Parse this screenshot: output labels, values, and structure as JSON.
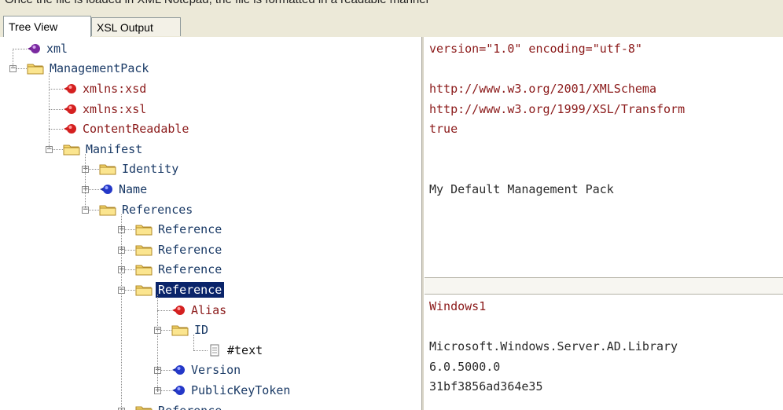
{
  "top_strip_text": "Once the file is loaded in XML Notepad, the file is formatted in a readable manner",
  "tabs": [
    {
      "label": "Tree View",
      "active": true
    },
    {
      "label": "XSL Output",
      "active": false
    }
  ],
  "tree": [
    {
      "label": "xml",
      "kind": "pi"
    },
    {
      "label": "ManagementPack",
      "kind": "folder"
    },
    {
      "label": "xmlns:xsd",
      "kind": "attr"
    },
    {
      "label": "xmlns:xsl",
      "kind": "attr"
    },
    {
      "label": "ContentReadable",
      "kind": "attr"
    },
    {
      "label": "Manifest",
      "kind": "folder"
    },
    {
      "label": "Identity",
      "kind": "folder"
    },
    {
      "label": "Name",
      "kind": "element"
    },
    {
      "label": "References",
      "kind": "folder"
    },
    {
      "label": "Reference",
      "kind": "folder"
    },
    {
      "label": "Reference",
      "kind": "folder"
    },
    {
      "label": "Reference",
      "kind": "folder"
    },
    {
      "label": "Reference",
      "kind": "folder",
      "selected": true
    },
    {
      "label": "Alias",
      "kind": "attr"
    },
    {
      "label": "ID",
      "kind": "folder"
    },
    {
      "label": "#text",
      "kind": "text"
    },
    {
      "label": "Version",
      "kind": "element"
    },
    {
      "label": "PublicKeyToken",
      "kind": "element"
    },
    {
      "label": "Reference",
      "kind": "folder"
    }
  ],
  "values_top": [
    "version=\"1.0\" encoding=\"utf-8\"",
    "",
    "http://www.w3.org/2001/XMLSchema",
    "http://www.w3.org/1999/XSL/Transform",
    "true",
    "",
    "",
    "My Default Management Pack"
  ],
  "values_bottom": [
    "Windows1",
    "",
    "Microsoft.Windows.Server.AD.Library",
    "6.0.5000.0",
    "31bf3856ad364e35"
  ],
  "icons": {
    "folder": "folder-icon",
    "attr": "attribute-icon",
    "element": "element-icon",
    "pi": "processing-instruction-icon",
    "text": "text-node-icon"
  },
  "colors": {
    "selection": "#0a246a",
    "attribute_text": "#8b1a1a",
    "element_text": "#1a3a66",
    "folder_yellow": "#f5d56a"
  }
}
